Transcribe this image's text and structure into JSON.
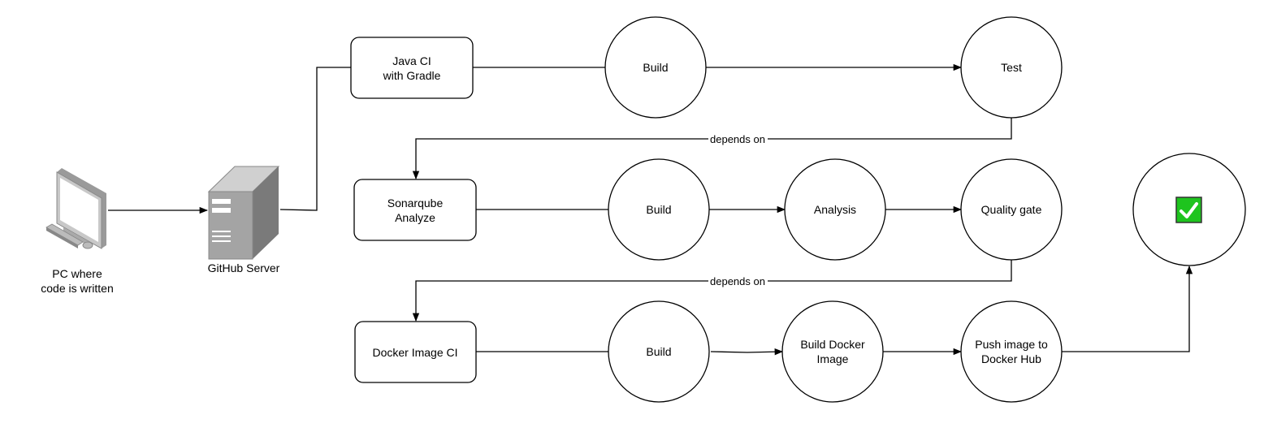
{
  "pc": {
    "label_line1": "PC where",
    "label_line2": "code is written",
    "icon": "desktop-computer-icon"
  },
  "server": {
    "label": "GitHub Server",
    "icon": "server-tower-icon"
  },
  "pipelines": [
    {
      "name_line1": "Java CI",
      "name_line2": "with Gradle",
      "steps": [
        {
          "line1": "Build"
        },
        {
          "line1": "Test"
        }
      ]
    },
    {
      "name_line1": "Sonarqube",
      "name_line2": "Analyze",
      "steps": [
        {
          "line1": "Build"
        },
        {
          "line1": "Analysis"
        },
        {
          "line1": "Quality gate"
        }
      ]
    },
    {
      "name_line1": "Docker Image CI",
      "steps": [
        {
          "line1": "Build"
        },
        {
          "line1": "Build Docker",
          "line2": "Image"
        },
        {
          "line1": "Push image to",
          "line2": "Docker Hub"
        }
      ]
    }
  ],
  "dependency_label": "depends on",
  "success": {
    "icon": "green-checkmark-icon",
    "color": "#1ec41e"
  }
}
